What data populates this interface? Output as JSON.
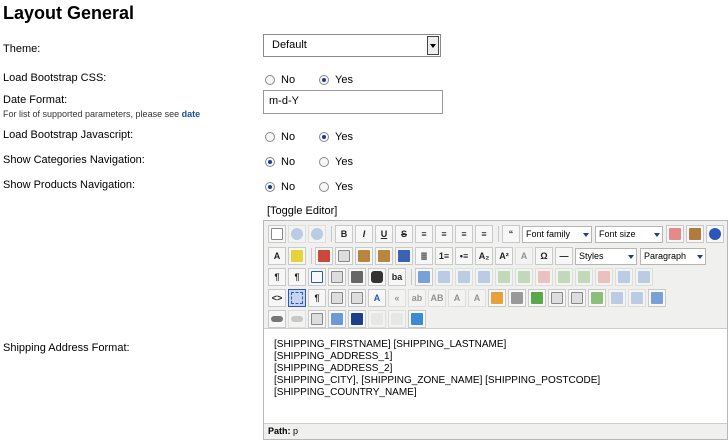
{
  "page": {
    "title": "Layout General"
  },
  "fields": {
    "theme": {
      "label": "Theme:",
      "value": "Default"
    },
    "bootstrap_css": {
      "label": "Load Bootstrap CSS:",
      "no": "No",
      "yes": "Yes",
      "selected": "Yes"
    },
    "date_format": {
      "label": "Date Format:",
      "help": "For list of supported parameters, please see",
      "help_link": "date",
      "value": "m-d-Y"
    },
    "bootstrap_js": {
      "label": "Load Bootstrap Javascript:",
      "no": "No",
      "yes": "Yes",
      "selected": "Yes"
    },
    "categories_nav": {
      "label": "Show Categories Navigation:",
      "no": "No",
      "yes": "Yes",
      "selected": "No"
    },
    "products_nav": {
      "label": "Show Products Navigation:",
      "no": "No",
      "yes": "Yes",
      "selected": "No"
    },
    "shipping_address": {
      "label": "Shipping Address Format:"
    }
  },
  "editor": {
    "toggle_label": "[Toggle Editor]",
    "font_family": "Font family",
    "font_size": "Font size",
    "styles": "Styles",
    "paragraph": "Paragraph",
    "content_lines": [
      "[SHIPPING_FIRSTNAME] [SHIPPING_LASTNAME]",
      "[SHIPPING_ADDRESS_1]",
      "[SHIPPING_ADDRESS_2]",
      "[SHIPPING_CITY], [SHIPPING_ZONE_NAME] [SHIPPING_POSTCODE]",
      "[SHIPPING_COUNTRY_NAME]"
    ],
    "path_label": "Path:",
    "path_value": "p"
  },
  "colors": {
    "accent": "#1b3f8a",
    "link": "#1a4fa0",
    "toolbar_bg": "#f0f0ee"
  }
}
